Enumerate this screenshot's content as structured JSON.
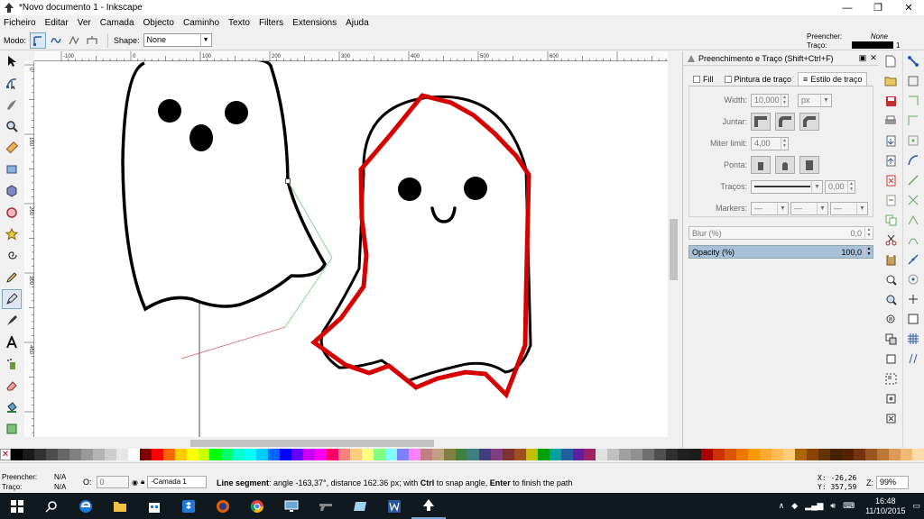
{
  "window": {
    "title": "*Novo documento 1 - Inkscape",
    "min_glyph": "—",
    "max_glyph": "❐",
    "close_glyph": "✕"
  },
  "menu": [
    "Ficheiro",
    "Editar",
    "Ver",
    "Camada",
    "Objecto",
    "Caminho",
    "Texto",
    "Filters",
    "Extensions",
    "Ajuda"
  ],
  "tool_controls": {
    "mode_label": "Modo:",
    "shape_label": "Shape:",
    "shape_value": "None"
  },
  "fill_stroke_indicator": {
    "fill_label": "Preencher:",
    "fill_value": "None",
    "stroke_label": "Traço:",
    "stroke_width": "1"
  },
  "rulers": {
    "h_ticks": [
      "-100",
      "0",
      "100",
      "200",
      "300",
      "400",
      "500",
      "600"
    ],
    "v_ticks": [
      "0",
      "100",
      "200",
      "300",
      "400"
    ]
  },
  "dock": {
    "title": "Preenchimento e Traço (Shift+Ctrl+F)",
    "tabs": [
      "Fill",
      "Pintura de traço",
      "Estilo de traço"
    ],
    "width_label": "Width:",
    "width_value": "10,000",
    "width_unit": "px",
    "join_label": "Juntar:",
    "miter_label": "Miter limit:",
    "miter_value": "4,00",
    "cap_label": "Ponta:",
    "dash_label": "Traços:",
    "dash_value": "0,00",
    "markers_label": "Markers:",
    "blur_label": "Blur (%)",
    "blur_value": "0,0",
    "opacity_label": "Opacity (%)",
    "opacity_value": "100,0"
  },
  "palette": [
    "#000000",
    "#1a1a1a",
    "#333333",
    "#4d4d4d",
    "#666666",
    "#808080",
    "#999999",
    "#b3b3b3",
    "#cccccc",
    "#e6e6e6",
    "#ffffff",
    "#800000",
    "#ff0000",
    "#ff6600",
    "#ffcc00",
    "#ffff00",
    "#ccff00",
    "#00ff00",
    "#00ff66",
    "#00ffcc",
    "#00ffff",
    "#00ccff",
    "#0066ff",
    "#0000ff",
    "#6600ff",
    "#cc00ff",
    "#ff00ff",
    "#ff0066",
    "#ff8080",
    "#ffcc80",
    "#ffff80",
    "#80ff80",
    "#80ffff",
    "#8080ff",
    "#ff80ff",
    "#c08080",
    "#c0a080",
    "#808040",
    "#408040",
    "#408080",
    "#404080",
    "#804080",
    "#803030",
    "#a05020",
    "#c0c000",
    "#00a000",
    "#00a0a0",
    "#2060a0",
    "#6020a0",
    "#a02060",
    "#e0e0e0",
    "#c0c0c0",
    "#a0a0a0",
    "#909090",
    "#707070",
    "#505050",
    "#303030",
    "#202020",
    "#1c1c1c",
    "#aa0000",
    "#cc3300",
    "#dd5500",
    "#ee7700",
    "#ff9900",
    "#ffaa33",
    "#ffbb55",
    "#ffcc77",
    "#aa6600",
    "#884400",
    "#663300",
    "#442200",
    "#552200",
    "#773311",
    "#995522",
    "#bb7733",
    "#dd9955",
    "#eebb77",
    "#ffddaa"
  ],
  "status": {
    "fill_label": "Preencher:",
    "fill_value": "N/A",
    "stroke_label": "Traço:",
    "stroke_value": "N/A",
    "opacity_label": "O:",
    "opacity_value": "0",
    "layer_value": "-Camada 1",
    "message_bold1": "Line segment",
    "message_text1": ": angle -163,37°, distance 162.36 px; with ",
    "message_bold2": "Ctrl",
    "message_text2": " to snap angle, ",
    "message_bold3": "Enter",
    "message_text3": " to finish the path",
    "x_label": "X:",
    "x_value": "-26,26",
    "y_label": "Y:",
    "y_value": "357,59",
    "zoom_label": "Z:",
    "zoom_value": "99%"
  },
  "taskbar": {
    "time": "16:48",
    "date": "11/10/2015"
  }
}
